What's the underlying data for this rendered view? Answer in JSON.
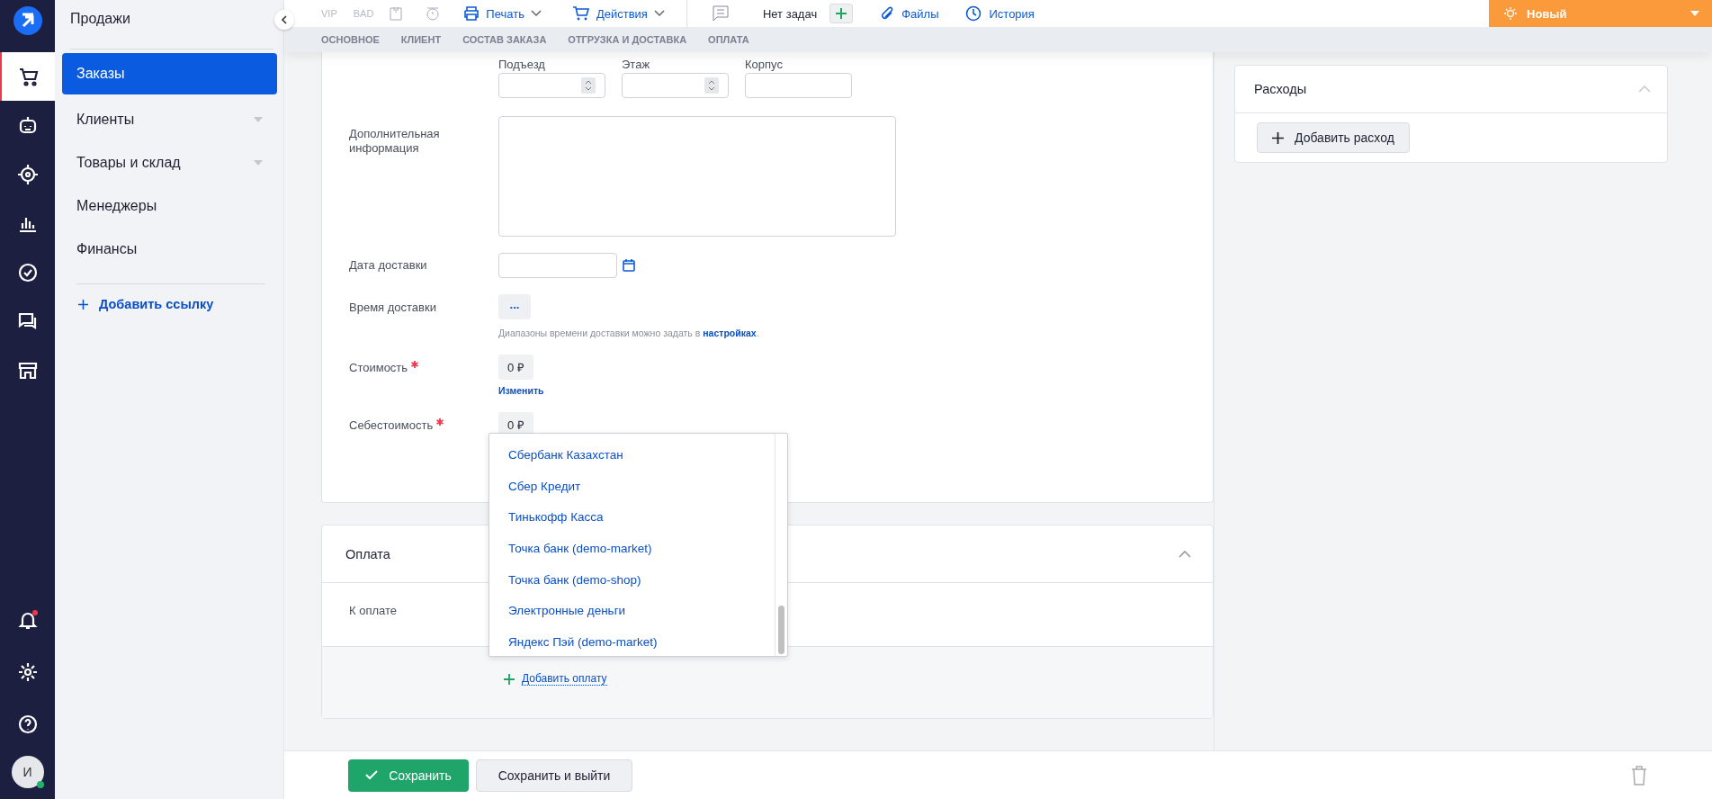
{
  "rail": {
    "items": [
      {
        "kind": "cart",
        "selected": true
      },
      {
        "kind": "robot",
        "selected": false
      },
      {
        "kind": "target",
        "selected": false
      },
      {
        "kind": "chart",
        "selected": false
      },
      {
        "kind": "check",
        "selected": false
      },
      {
        "kind": "chat",
        "selected": false
      },
      {
        "kind": "store",
        "selected": false
      }
    ],
    "bottom": [
      {
        "kind": "bell",
        "badge": true
      },
      {
        "kind": "gear",
        "badge": false
      },
      {
        "kind": "help",
        "badge": false
      }
    ],
    "avatar": {
      "initial": "И",
      "online": true
    }
  },
  "sidebar": {
    "title": "Продажи",
    "items": [
      {
        "label": "Заказы",
        "selected": true,
        "has_submenu": false
      },
      {
        "label": "Клиенты",
        "selected": false,
        "has_submenu": true
      },
      {
        "label": "Товары и склад",
        "selected": false,
        "has_submenu": true
      },
      {
        "label": "Менеджеры",
        "selected": false,
        "has_submenu": false
      },
      {
        "label": "Финансы",
        "selected": false,
        "has_submenu": false
      }
    ],
    "add_link": "Добавить ссылку"
  },
  "toolbar": {
    "flags": [
      "VIP",
      "BAD"
    ],
    "print": "Печать",
    "actions": "Действия",
    "tasks": "Нет задач",
    "files": "Файлы",
    "history": "История",
    "status": {
      "label": "Новый",
      "color": "#fb9a3a"
    }
  },
  "tabs": [
    {
      "label": "ОСНОВНОЕ",
      "selected": false
    },
    {
      "label": "КЛИЕНТ",
      "selected": false
    },
    {
      "label": "СОСТАВ ЗАКАЗА",
      "selected": false
    },
    {
      "label": "ОТГРУЗКА И ДОСТАВКА",
      "selected": false
    },
    {
      "label": "ОПЛАТА",
      "selected": false
    }
  ],
  "address_fields": [
    {
      "label": "Подъезд",
      "kind": "number"
    },
    {
      "label": "Этаж",
      "kind": "number"
    },
    {
      "label": "Корпус",
      "kind": "text"
    }
  ],
  "form": {
    "extra_info": "Дополнительная информация",
    "delivery_date": "Дата доставки",
    "delivery_time": "Время доставки",
    "time_button": "...",
    "hint": "Диапазоны времени доставки можно задать в",
    "hint_link": "настройках",
    "hint_end": ".",
    "cost": {
      "label": "Стоимость",
      "required": true,
      "value": "0 ₽",
      "change": "Изменить"
    },
    "net_cost": {
      "label": "Себестоимость",
      "required": true,
      "value": "0 ₽"
    }
  },
  "dropdown": [
    "Сбербанк Казахстан",
    "Сбер Кредит",
    "Тинькофф Касса",
    "Точка банк (demo-market)",
    "Точка банк (demo-shop)",
    "Электронные деньги",
    "Яндекс Пэй (demo-market)"
  ],
  "payment": {
    "title": "Оплата",
    "expanded": true,
    "to_pay": "К оплате",
    "add": "Добавить оплату"
  },
  "expenses": {
    "title": "Расходы",
    "expanded": true,
    "add": "Добавить расход"
  },
  "footer": {
    "save": "Сохранить",
    "save_exit": "Сохранить и выйти"
  }
}
